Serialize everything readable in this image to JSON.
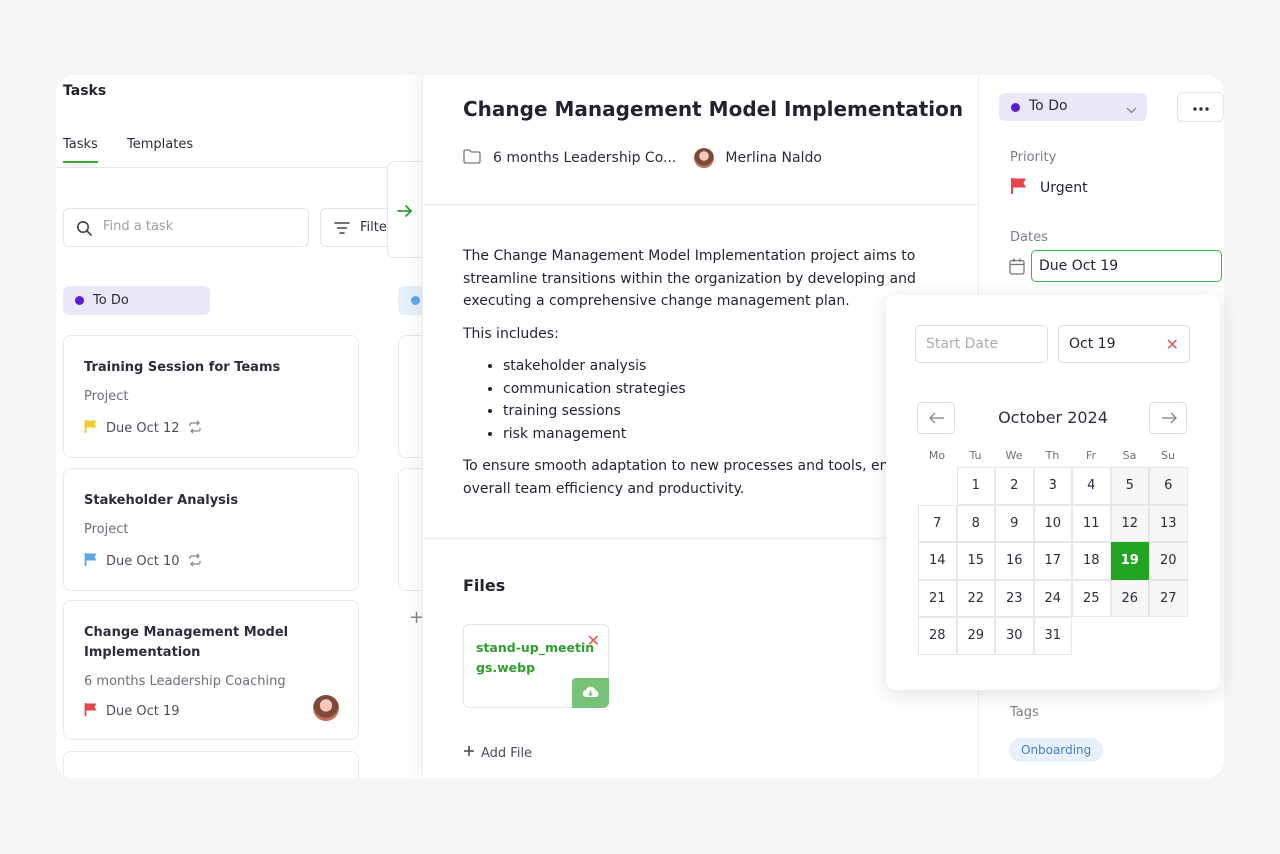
{
  "left": {
    "title": "Tasks",
    "tabs": [
      {
        "label": "Tasks",
        "active": true
      },
      {
        "label": "Templates",
        "active": false
      }
    ],
    "search_placeholder": "Find a task",
    "filter_label": "Filter",
    "column": {
      "status": "To Do",
      "dot_color": "#5b1fd1"
    },
    "cards": [
      {
        "title": "Training Session for Teams",
        "sub": "Project",
        "due": "Due Oct 12",
        "flag_color": "#f0cc2a",
        "repeat": true
      },
      {
        "title": "Stakeholder Analysis",
        "sub": "Project",
        "due": "Due Oct 10",
        "flag_color": "#5ea8ea",
        "repeat": true
      },
      {
        "title": "Change Management Model Implementation",
        "sub": "6 months Leadership Coaching",
        "due": "Due Oct 19",
        "flag_color": "#e8454a",
        "avatar": true
      }
    ]
  },
  "detail": {
    "title": "Change Management Model Implementation",
    "project": "6 months Leadership Co...",
    "assignee": "Merlina Naldo",
    "description": {
      "intro": "The Change Management Model Implementation project aims to streamline transitions within the organization by developing and executing a comprehensive change management plan.",
      "includes": "This includes:",
      "items": [
        "stakeholder analysis",
        "communication strategies",
        "training sessions",
        "risk management"
      ],
      "outro": "To ensure smooth adaptation to new processes and tools, enhancing overall team efficiency and productivity."
    },
    "files_title": "Files",
    "file_name": "stand-up_meetings.webp",
    "add_file": "Add File"
  },
  "sidebar": {
    "status": "To Do",
    "priority_label": "Priority",
    "priority": "Urgent",
    "dates_label": "Dates",
    "due_value": "Due Oct 19",
    "tags_label": "Tags",
    "tags": [
      "Onboarding"
    ]
  },
  "picker": {
    "start_placeholder": "Start Date",
    "end_value": "Oct 19",
    "month": "October 2024",
    "weekdays": [
      "Mo",
      "Tu",
      "We",
      "Th",
      "Fr",
      "Sa",
      "Su"
    ],
    "first_weekday_index": 1,
    "days_in_month": 31,
    "selected_day": 19
  },
  "colors": {
    "accent": "#22a522",
    "urgent": "#e8454a"
  }
}
